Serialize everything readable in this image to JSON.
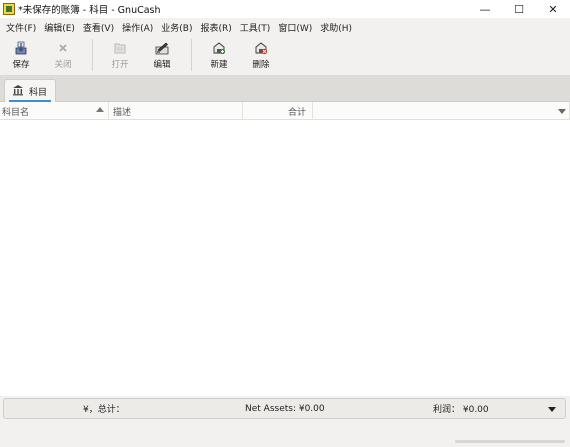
{
  "window": {
    "title": "*未保存的账簿 - 科目 - GnuCash",
    "minimize_glyph": "—",
    "maximize_glyph": "☐",
    "close_glyph": "✕"
  },
  "menu": {
    "items": [
      "文件(F)",
      "编辑(E)",
      "查看(V)",
      "操作(A)",
      "业务(B)",
      "报表(R)",
      "工具(T)",
      "窗口(W)",
      "求助(H)"
    ]
  },
  "toolbar": {
    "save": {
      "label": "保存",
      "icon": "save-icon",
      "enabled": true
    },
    "close": {
      "label": "关闭",
      "icon": "close-icon",
      "enabled": false
    },
    "open": {
      "label": "打开",
      "icon": "open-icon",
      "enabled": false
    },
    "edit": {
      "label": "编辑",
      "icon": "edit-icon",
      "enabled": true
    },
    "new": {
      "label": "新建",
      "icon": "new-account-icon",
      "enabled": true
    },
    "delete": {
      "label": "删除",
      "icon": "delete-account-icon",
      "enabled": true
    }
  },
  "tabs": [
    {
      "label": "科目",
      "icon": "accounts-icon",
      "active": true
    }
  ],
  "tree": {
    "columns": {
      "name": "科目名",
      "description": "描述",
      "total": "合计"
    },
    "rows": []
  },
  "summary": {
    "total_label": "¥，总计：",
    "net_assets": "Net Assets: ¥0.00",
    "profit": "利润：  ¥0.00"
  },
  "colors": {
    "tab_accent": "#3b8fd6",
    "background": "#f2f1ef"
  }
}
